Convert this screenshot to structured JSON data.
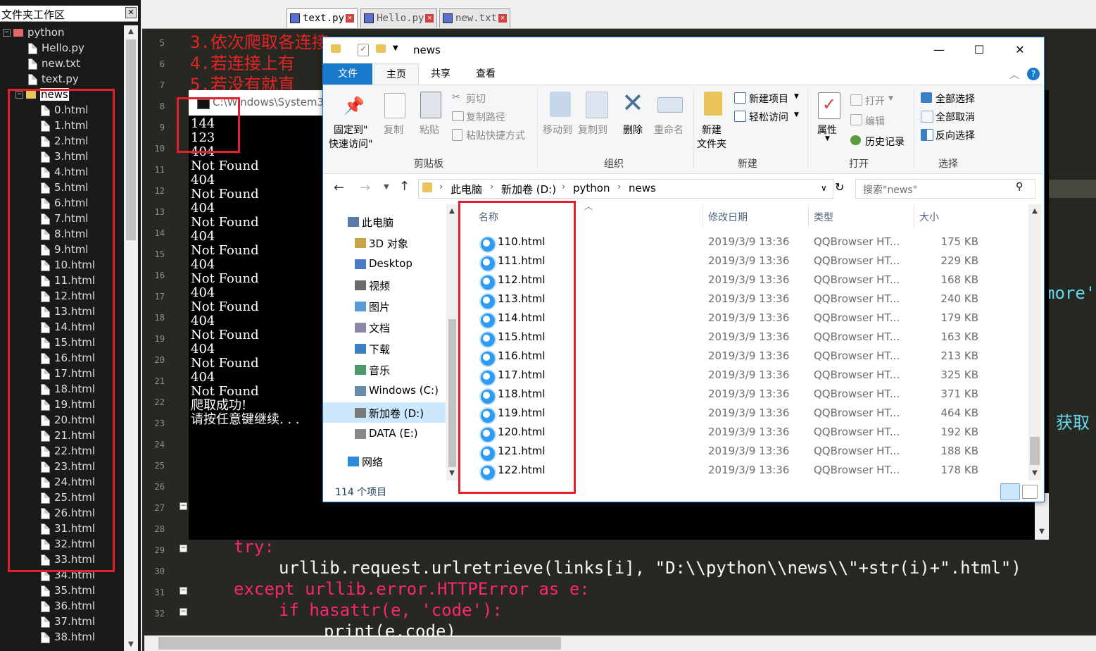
{
  "workspace": {
    "title": "文件夹工作区",
    "close_glyph": "✕",
    "tree": {
      "root": "python",
      "root_files": [
        "Hello.py",
        "new.txt",
        "text.py"
      ],
      "folder": "news",
      "folder_files": [
        "0.html",
        "1.html",
        "2.html",
        "3.html",
        "4.html",
        "5.html",
        "6.html",
        "7.html",
        "8.html",
        "9.html",
        "10.html",
        "11.html",
        "12.html",
        "13.html",
        "14.html",
        "15.html",
        "16.html",
        "17.html",
        "18.html",
        "19.html",
        "20.html",
        "21.html",
        "22.html",
        "23.html",
        "24.html",
        "25.html",
        "26.html",
        "31.html",
        "32.html",
        "33.html",
        "34.html",
        "35.html",
        "36.html",
        "37.html",
        "38.html"
      ]
    }
  },
  "editor": {
    "tabs": [
      "text.py",
      "Hello.py",
      "new.txt"
    ],
    "line_numbers": [
      "5",
      "6",
      "7",
      "8",
      "9",
      "10",
      "11",
      "12",
      "13",
      "14",
      "15",
      "16",
      "17",
      "18",
      "19",
      "20",
      "21",
      "22",
      "23",
      "24",
      "25",
      "26",
      "27",
      "28",
      "29",
      "30",
      "31",
      "32"
    ],
    "comment_lines": [
      "3.依次爬取各连接",
      "4.若连接上有",
      "5.若没有就直"
    ],
    "code_lines": {
      "try": "try:",
      "retrieve": "urllib.request.urlretrieve(links[i], \"D:\\\\python\\\\news\\\\\"+str(i)+\".html\")",
      "except": "except urllib.error.HTTPError as e:",
      "if": "if hasattr(e, 'code'):",
      "print": "print(e.code)"
    },
    "right_fragments": {
      "more": "more'",
      "acquire": "获取"
    }
  },
  "console": {
    "title": "C:\\Windows\\System3",
    "lines": [
      "144",
      "123",
      "404",
      "Not Found",
      "404",
      "Not Found",
      "404",
      "Not Found",
      "404",
      "Not Found",
      "404",
      "Not Found",
      "404",
      "Not Found",
      "404",
      "Not Found",
      "404",
      "Not Found",
      "404",
      "Not Found",
      "爬取成功!",
      "请按任意键继续. . ."
    ]
  },
  "explorer": {
    "title": "news",
    "window_buttons": {
      "minimize": "—",
      "maximize": "☐",
      "close": "✕"
    },
    "ribbon_tabs": [
      "文件",
      "主页",
      "共享",
      "查看"
    ],
    "ribbon": {
      "clipboard": {
        "pin": [
          "固定到\"",
          "快速访问\""
        ],
        "copy": "复制",
        "paste": "粘贴",
        "cut": "剪切",
        "copy_path": "复制路径",
        "paste_shortcut": "粘贴快捷方式",
        "label": "剪贴板"
      },
      "organize": {
        "move_to": "移动到",
        "copy_to": "复制到",
        "delete": "删除",
        "rename": "重命名",
        "label": "组织"
      },
      "new": {
        "new_folder": [
          "新建",
          "文件夹"
        ],
        "new_item": "新建项目",
        "easy_access": "轻松访问",
        "label": "新建"
      },
      "open": {
        "properties": "属性",
        "open": "打开",
        "edit": "编辑",
        "history": "历史记录",
        "label": "打开"
      },
      "select": {
        "select_all": "全部选择",
        "select_none": "全部取消",
        "invert": "反向选择",
        "label": "选择"
      }
    },
    "address": [
      "此电脑",
      "新加卷 (D:)",
      "python",
      "news"
    ],
    "search_placeholder": "搜索\"news\"",
    "nav": [
      "此电脑",
      "3D 对象",
      "Desktop",
      "视频",
      "图片",
      "文档",
      "下载",
      "音乐",
      "Windows (C:)",
      "新加卷 (D:)",
      "DATA (E:)",
      "网络"
    ],
    "columns": {
      "name": "名称",
      "date": "修改日期",
      "type": "类型",
      "size": "大小"
    },
    "files": [
      {
        "name": "110.html",
        "date": "2019/3/9 13:36",
        "type": "QQBrowser HT...",
        "size": "175 KB"
      },
      {
        "name": "111.html",
        "date": "2019/3/9 13:36",
        "type": "QQBrowser HT...",
        "size": "229 KB"
      },
      {
        "name": "112.html",
        "date": "2019/3/9 13:36",
        "type": "QQBrowser HT...",
        "size": "168 KB"
      },
      {
        "name": "113.html",
        "date": "2019/3/9 13:36",
        "type": "QQBrowser HT...",
        "size": "240 KB"
      },
      {
        "name": "114.html",
        "date": "2019/3/9 13:36",
        "type": "QQBrowser HT...",
        "size": "179 KB"
      },
      {
        "name": "115.html",
        "date": "2019/3/9 13:36",
        "type": "QQBrowser HT...",
        "size": "163 KB"
      },
      {
        "name": "116.html",
        "date": "2019/3/9 13:36",
        "type": "QQBrowser HT...",
        "size": "213 KB"
      },
      {
        "name": "117.html",
        "date": "2019/3/9 13:36",
        "type": "QQBrowser HT...",
        "size": "325 KB"
      },
      {
        "name": "118.html",
        "date": "2019/3/9 13:36",
        "type": "QQBrowser HT...",
        "size": "371 KB"
      },
      {
        "name": "119.html",
        "date": "2019/3/9 13:36",
        "type": "QQBrowser HT...",
        "size": "464 KB"
      },
      {
        "name": "120.html",
        "date": "2019/3/9 13:36",
        "type": "QQBrowser HT...",
        "size": "192 KB"
      },
      {
        "name": "121.html",
        "date": "2019/3/9 13:36",
        "type": "QQBrowser HT...",
        "size": "188 KB"
      },
      {
        "name": "122.html",
        "date": "2019/3/9 13:36",
        "type": "QQBrowser HT...",
        "size": "178 KB"
      }
    ],
    "status": "114 个项目"
  },
  "colors": {
    "accent": "#1979ca",
    "highlight_box": "#e4202a",
    "editor_bg": "#272822",
    "keyword": "#f92672",
    "string": "#e6db74"
  }
}
